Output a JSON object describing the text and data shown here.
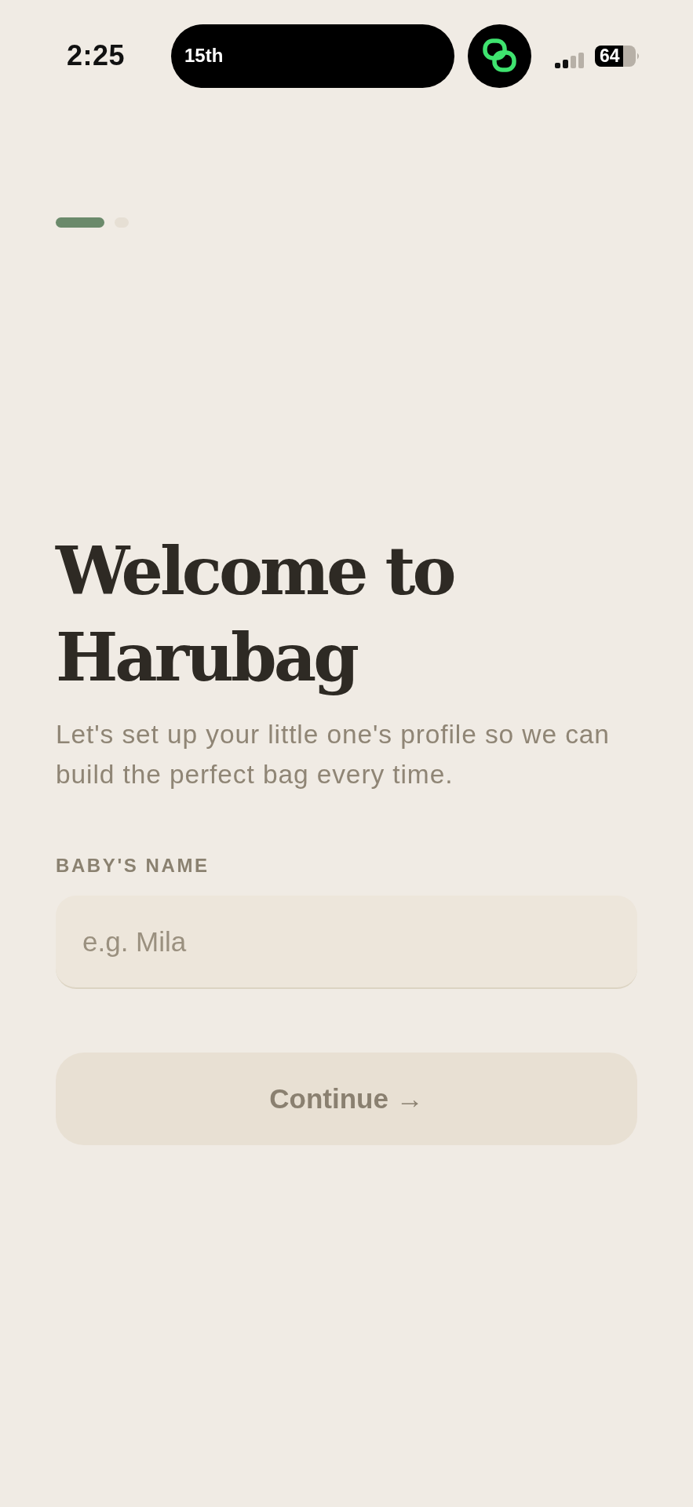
{
  "status_bar": {
    "time": "2:25",
    "live_activity": "15th",
    "battery": "64"
  },
  "progress": {
    "steps": [
      {
        "selected": true
      },
      {
        "selected": false
      }
    ]
  },
  "title": "Welcome to Harubag",
  "subtitle": "Let's set up your little one's profile so we can build the perfect bag every time.",
  "name_field": {
    "label": "BABY'S NAME",
    "placeholder": "e.g. Mila"
  },
  "continue_button": {
    "label": "Continue →",
    "disabled": true
  }
}
